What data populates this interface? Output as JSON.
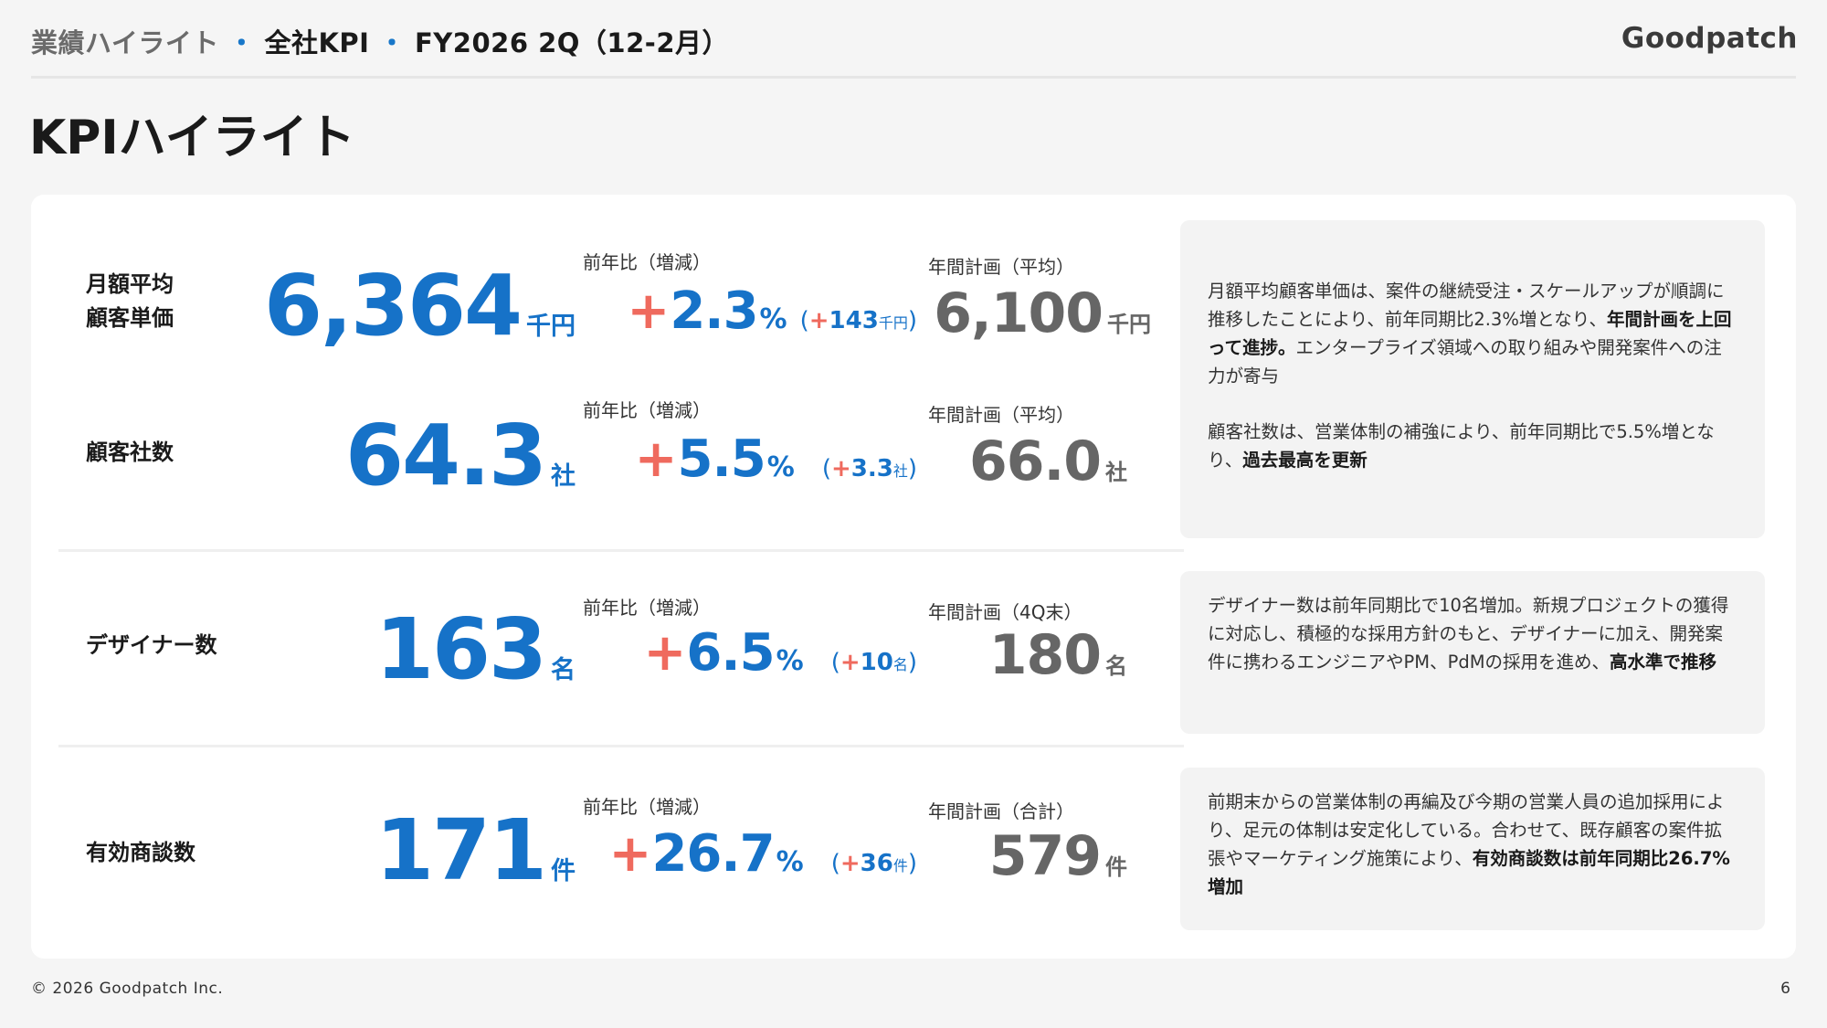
{
  "header": {
    "crumb_1": "業績ハイライト",
    "crumb_2": "全社KPI",
    "crumb_3": "FY2026 2Q（12-2月）",
    "separator": "・",
    "logo": "Goodpatch"
  },
  "page_title": "KPIハイライト",
  "yoy_label": "前年比（増減）",
  "kpis": [
    {
      "label_line1": "月額平均",
      "label_line2": "顧客単価",
      "value": "6,364",
      "unit": "千円",
      "yoy_sign": "+",
      "yoy_value": "2.3",
      "yoy_unit": "%",
      "delta_sign": "+",
      "delta_value": "143",
      "delta_unit": "千円",
      "plan_label": "年間計画（平均）",
      "plan_value": "6,100",
      "plan_unit": "千円"
    },
    {
      "label_line1": "顧客社数",
      "label_line2": "",
      "value": "64.3",
      "unit": "社",
      "yoy_sign": "+",
      "yoy_value": "5.5",
      "yoy_unit": "%",
      "delta_sign": "+",
      "delta_value": "3.3",
      "delta_unit": "社",
      "plan_label": "年間計画（平均）",
      "plan_value": "66.0",
      "plan_unit": "社"
    },
    {
      "label_line1": "デザイナー数",
      "label_line2": "",
      "value": "163",
      "unit": "名",
      "yoy_sign": "+",
      "yoy_value": "6.5",
      "yoy_unit": "%",
      "delta_sign": "+",
      "delta_value": "10",
      "delta_unit": "名",
      "plan_label": "年間計画（4Q末）",
      "plan_value": "180",
      "plan_unit": "名"
    },
    {
      "label_line1": "有効商談数",
      "label_line2": "",
      "value": "171",
      "unit": "件",
      "yoy_sign": "+",
      "yoy_value": "26.7",
      "yoy_unit": "%",
      "delta_sign": "+",
      "delta_value": "36",
      "delta_unit": "件",
      "plan_label": "年間計画（合計）",
      "plan_value": "579",
      "plan_unit": "件"
    }
  ],
  "notes": {
    "n1_p1_a": "月額平均顧客単価は、案件の継続受注・スケールアップが順調に推移したことにより、前年同期比2.3%増となり、",
    "n1_p1_b": "年間計画を上回って進捗。",
    "n1_p1_c": "エンタープライズ領域への取り組みや開発案件への注力が寄与",
    "n1_p2_a": "顧客社数は、営業体制の補強により、前年同期比で5.5%増となり、",
    "n1_p2_b": "過去最高を更新",
    "n2_a": "デザイナー数は前年同期比で10名増加。新規プロジェクトの獲得に対応し、積極的な採用方針のもと、デザイナーに加え、開発案件に携わるエンジニアやPM、PdMの採用を進め、",
    "n2_b": "高水準で推移",
    "n3_a": "前期末からの営業体制の再編及び今期の営業人員の追加採用により、足元の体制は安定化している。合わせて、既存顧客の案件拡張やマーケティング施策により、",
    "n3_b": "有効商談数は前年同期比26.7%増加"
  },
  "footer": {
    "copyright": "© 2026 Goodpatch Inc.",
    "page_number": "6"
  }
}
